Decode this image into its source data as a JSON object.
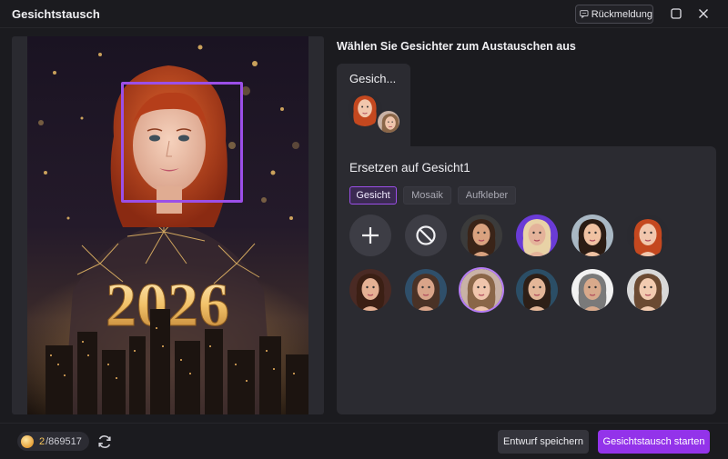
{
  "window": {
    "title": "Gesichtstausch",
    "feedback_label": "Rückmeldung"
  },
  "colors": {
    "accent": "#9b4fe8",
    "primary_button": "#9333ea",
    "background": "#1b1b1f",
    "panel": "#2b2b31",
    "credit": "#f6c45a"
  },
  "main_image": {
    "caption_text": "2026"
  },
  "panel": {
    "heading": "Wählen Sie Gesichter zum Austauschen aus",
    "face_tab_label": "Gesich...",
    "replace_title": "Ersetzen auf Gesicht1",
    "filters": [
      "Gesicht",
      "Mosaik",
      "Aufkleber"
    ],
    "active_filter": "Gesicht",
    "tools": [
      {
        "name": "add-face",
        "icon": "plus-icon"
      },
      {
        "name": "no-face",
        "icon": "ban-icon"
      }
    ],
    "faces": [
      {
        "name": "face-young-man-dark-hair",
        "skin": "#d9a27f",
        "hair": "#3a2418",
        "bg": "#3b3b3b"
      },
      {
        "name": "face-blonde-woman-neon",
        "skin": "#e4b39a",
        "hair": "#e8d2a6",
        "bg": "#6a3bd6"
      },
      {
        "name": "face-baby-dark-hair",
        "skin": "#f0c2a2",
        "hair": "#2b1c14",
        "bg": "#a9b8c4"
      },
      {
        "name": "face-redhead-woman",
        "skin": "#f1c7ad",
        "hair": "#c4481f",
        "bg": "#2a2a30"
      },
      {
        "name": "face-woman-dark-makeup",
        "skin": "#e5b194",
        "hair": "#3b1f14",
        "bg": "#4a2a24"
      },
      {
        "name": "face-teen-boy",
        "skin": "#d9a489",
        "hair": "#4a3226",
        "bg": "#2f4f6a"
      },
      {
        "name": "face-woman-light-hair-selected",
        "skin": "#f0c5ac",
        "hair": "#8a6648",
        "bg": "#c9b2a6"
      },
      {
        "name": "face-woman-business",
        "skin": "#e3b698",
        "hair": "#2d1f17",
        "bg": "#2b4e66"
      },
      {
        "name": "face-man-glasses-suit",
        "skin": "#d8a98b",
        "hair": "#7a7a7a",
        "bg": "#f2f2f2"
      },
      {
        "name": "face-baby-light",
        "skin": "#f2cbb0",
        "hair": "#6b4a32",
        "bg": "#d8d8d8"
      }
    ],
    "selected_face_index": 6
  },
  "footer": {
    "credits_used": "2",
    "credits_total": "/869517",
    "save_label": "Entwurf speichern",
    "start_label": "Gesichtstausch starten"
  }
}
